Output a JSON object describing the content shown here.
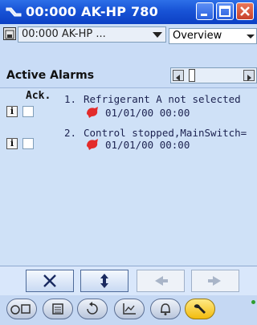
{
  "window": {
    "title": "00:000 AK-HP 780"
  },
  "device_row": {
    "device_value": "00:000 AK-HP ...",
    "view_value": "Overview"
  },
  "alarms_panel": {
    "title": "Active Alarms",
    "ack_header": "Ack.",
    "alarms": [
      {
        "number": "1.",
        "text": "Refrigerant A not selected",
        "timestamp": "01/01/00 00:00"
      },
      {
        "number": "2.",
        "text": "Control stopped,MainSwitch=",
        "timestamp": "01/01/00 00:00"
      }
    ],
    "info_label": "i"
  },
  "toolbar": {
    "buttons": [
      {
        "icon": "close-x-icon",
        "enabled": true
      },
      {
        "icon": "refresh-arrows-icon",
        "enabled": true
      },
      {
        "icon": "left-arrow-icon",
        "enabled": false
      },
      {
        "icon": "right-arrow-icon",
        "enabled": false
      }
    ]
  },
  "bottom_nav": {
    "items": [
      {
        "icon": "network-icon",
        "active": false
      },
      {
        "icon": "calculator-icon",
        "active": false
      },
      {
        "icon": "history-icon",
        "active": false
      },
      {
        "icon": "trend-chart-icon",
        "active": false
      },
      {
        "icon": "bell-icon",
        "active": false
      },
      {
        "icon": "wrench-icon",
        "active": true
      }
    ]
  },
  "colors": {
    "titlebar": "#1853d6",
    "list_background": "#cfe1f7",
    "alarm_bell": "#e32b2b",
    "active_nav": "#f2bb0e"
  }
}
